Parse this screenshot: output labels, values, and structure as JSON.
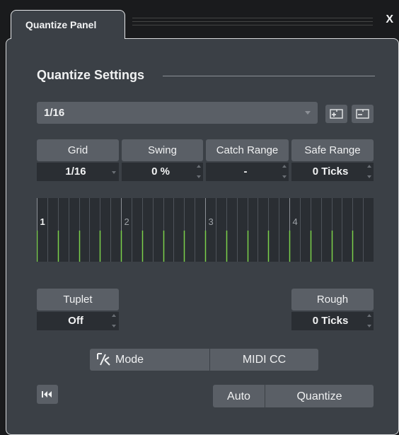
{
  "window": {
    "tab_title": "Quantize Panel",
    "close_glyph": "X"
  },
  "section_title": "Quantize Settings",
  "preset": {
    "value": "1/16",
    "add_icon": "add-preset-icon",
    "remove_icon": "remove-preset-icon"
  },
  "params": {
    "grid": {
      "label": "Grid",
      "value": "1/16"
    },
    "swing": {
      "label": "Swing",
      "value": "0 %"
    },
    "catch_range": {
      "label": "Catch Range",
      "value": "-"
    },
    "safe_range": {
      "label": "Safe Range",
      "value": "0 Ticks"
    },
    "tuplet": {
      "label": "Tuplet",
      "value": "Off"
    },
    "rough": {
      "label": "Rough",
      "value": "0 Ticks"
    }
  },
  "grid_display": {
    "beats": [
      "1",
      "2",
      "3",
      "4"
    ],
    "notes_per_beat": 4,
    "subdivisions_per_beat": 8
  },
  "buttons": {
    "mode": "Mode",
    "midi_cc": "MIDI CC",
    "auto": "Auto",
    "quantize": "Quantize"
  },
  "colors": {
    "panel_bg": "#3b4046",
    "button_bg": "#5a5f66",
    "field_bg": "#2a2e33",
    "note_green": "#7bd14b",
    "gridline": "#4e535a"
  }
}
